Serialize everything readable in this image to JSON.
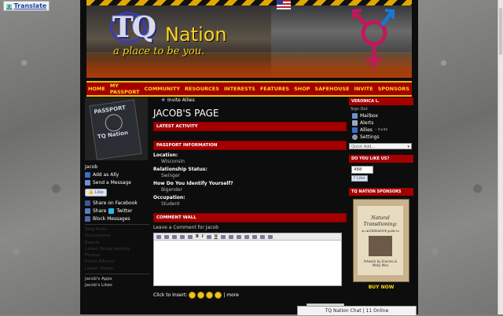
{
  "translate": {
    "label": "Translate"
  },
  "banner": {
    "logo_tq": "TQ",
    "logo_nation": "Nation",
    "tagline": "a place to be you."
  },
  "nav": [
    "HOME",
    "MY PASSPORT",
    "COMMUNITY",
    "RESOURCES",
    "INTERESTS",
    "FEATURES",
    "SHOP",
    "SAFEHOUSE",
    "INVITE",
    "SPONSORS"
  ],
  "left": {
    "passport": {
      "word": "PASSPORT",
      "brand": "TQ Nation"
    },
    "name": "Jacob",
    "add_ally": "Add as Ally",
    "send_message": "Send a Message",
    "like_label": "Like",
    "share_facebook": "Share on Facebook",
    "share": "Share",
    "twitter": "Twitter",
    "block": "Block Messages",
    "muted_links": [
      "Blog Posts",
      "Discussions",
      "Events",
      "Latest Group Activity",
      "Photos",
      "Photo Albums",
      "Latest Videos"
    ],
    "apps_title": "Jacob's Apps",
    "apps_item": "Jacob's Likes"
  },
  "center": {
    "invite_allies": "Invite Allies",
    "page_title": "JACOB'S PAGE",
    "latest_activity": "LATEST ACTIVITY",
    "passport_info": "PASSPORT INFORMATION",
    "fields": [
      {
        "label": "Location:",
        "value": "Wisconsin"
      },
      {
        "label": "Relationship Status:",
        "value": "Swinger"
      },
      {
        "label": "How Do You Identify Yourself?",
        "value": "Bigender"
      },
      {
        "label": "Occupation:",
        "value": "Student"
      }
    ],
    "comment_wall": "COMMENT WALL",
    "leave_comment": "Leave a Comment for Jacob",
    "click_to_insert": "Click to Insert:",
    "more": "| more"
  },
  "right": {
    "user_bar": "VERONICA L.",
    "sign_out": "Sign Out",
    "mailbox": "Mailbox",
    "alerts": "Alerts",
    "allies": "Allies",
    "invite": "– Invite",
    "settings": "Settings",
    "quick_add": "Quick Add...",
    "like_us": "DO YOU LIKE US?",
    "like_count": "488",
    "like_label": "Like",
    "sponsors": "TQ NATION SPONSORS",
    "book_title": "Natural Transitioning:",
    "book_sub": "an ALTERNATIVE guide to",
    "book_authors": "Artwork by Erasmo & Molly Mao",
    "buy_now": "BUY NOW"
  },
  "chat": {
    "label": "TQ Nation Chat | 11 Online"
  },
  "colors": {
    "brand_red": "#a40000",
    "brand_gold": "#ffd51e",
    "page_bg": "#0d0d0d"
  }
}
